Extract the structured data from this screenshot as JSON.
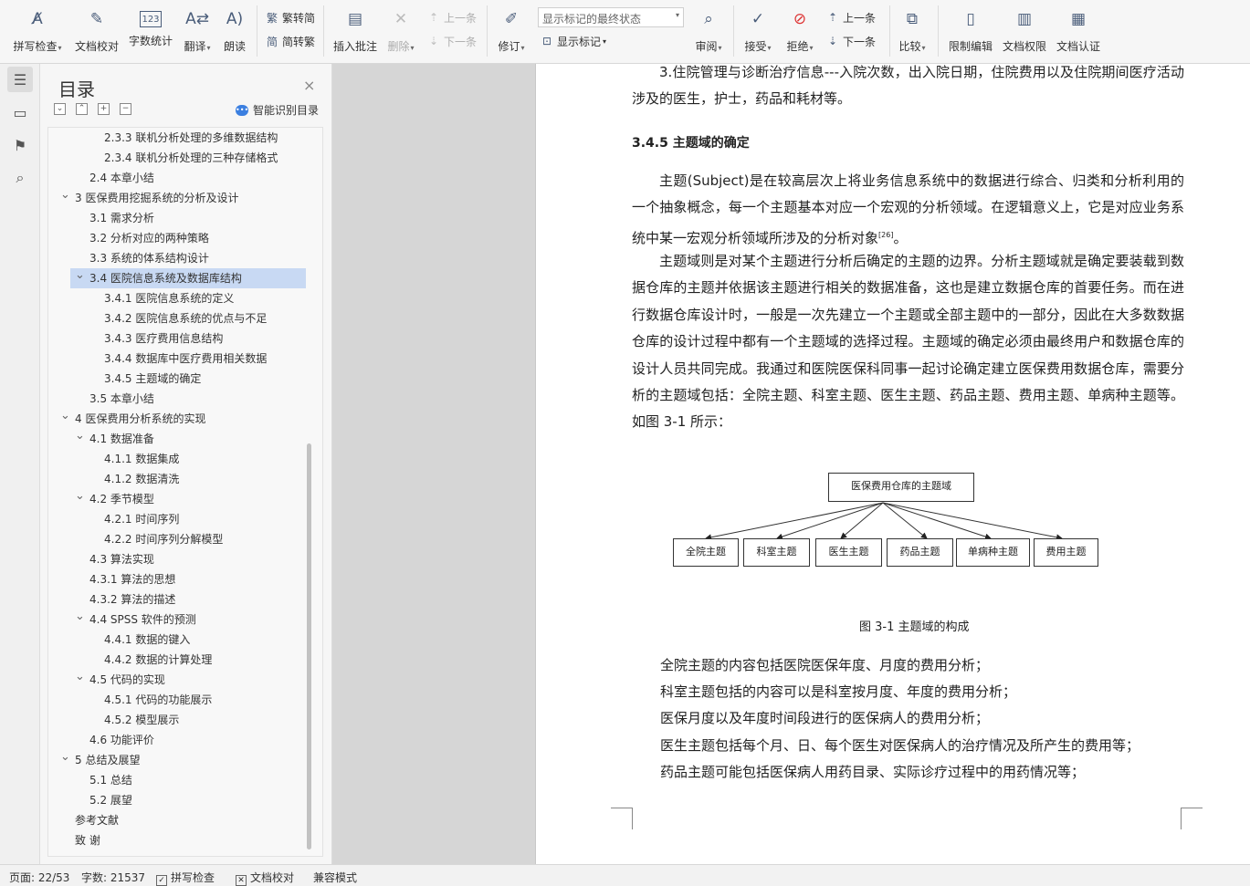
{
  "ribbon": {
    "spell_check": "拼写检查",
    "doc_proof": "文档校对",
    "word_count": "字数统计",
    "translate": "翻译",
    "read_aloud": "朗读",
    "trad_to_simp": "繁转简",
    "simp_to_trad": "简转繁",
    "insert_comment": "插入批注",
    "delete": "删除",
    "prev_comment": "上一条",
    "next_comment": "下一条",
    "track_changes": "修订",
    "markup_state": "显示标记的最终状态",
    "show_markup": "显示标记",
    "review": "审阅",
    "accept": "接受",
    "reject": "拒绝",
    "prev_change": "上一条",
    "next_change": "下一条",
    "compare": "比较",
    "restrict_edit": "限制编辑",
    "doc_permission": "文档权限",
    "doc_certify": "文档认证"
  },
  "toc": {
    "title": "目录",
    "smart_recognize": "智能识别目录",
    "items": [
      {
        "text": "2.3.3  联机分析处理的多维数据结构",
        "level": 3,
        "caret": ""
      },
      {
        "text": "2.3.4  联机分析处理的三种存储格式",
        "level": 3,
        "caret": ""
      },
      {
        "text": "2.4  本章小结",
        "level": 2,
        "caret": ""
      },
      {
        "text": "3  医保费用挖掘系统的分析及设计",
        "level": 1,
        "caret": "v"
      },
      {
        "text": "3.1  需求分析",
        "level": 2,
        "caret": ""
      },
      {
        "text": "3.2 分析对应的两种策略",
        "level": 2,
        "caret": ""
      },
      {
        "text": "3.3  系统的体系结构设计",
        "level": 2,
        "caret": ""
      },
      {
        "text": "3.4 医院信息系统及数据库结构",
        "level": 2,
        "caret": "v",
        "selected": true
      },
      {
        "text": "3.4.1 医院信息系统的定义",
        "level": 3,
        "caret": ""
      },
      {
        "text": "3.4.2 医院信息系统的优点与不足",
        "level": 3,
        "caret": ""
      },
      {
        "text": "3.4.3 医疗费用信息结构",
        "level": 3,
        "caret": ""
      },
      {
        "text": "3.4.4  数据库中医疗费用相关数据",
        "level": 3,
        "caret": ""
      },
      {
        "text": "3.4.5 主题域的确定",
        "level": 3,
        "caret": ""
      },
      {
        "text": "3.5    本章小结",
        "level": 2,
        "caret": ""
      },
      {
        "text": "4  医保费用分析系统的实现",
        "level": 1,
        "caret": "v"
      },
      {
        "text": "4.1  数据准备",
        "level": 2,
        "caret": "v"
      },
      {
        "text": "4.1.1  数据集成",
        "level": 3,
        "caret": ""
      },
      {
        "text": "4.1.2  数据清洗",
        "level": 3,
        "caret": ""
      },
      {
        "text": "4.2 季节模型",
        "level": 2,
        "caret": "v"
      },
      {
        "text": "4.2.1 时间序列",
        "level": 3,
        "caret": ""
      },
      {
        "text": "4.2.2  时间序列分解模型",
        "level": 3,
        "caret": ""
      },
      {
        "text": "4.3 算法实现",
        "level": 2,
        "caret": ""
      },
      {
        "text": "4.3.1 算法的思想",
        "level": 2,
        "caret": ""
      },
      {
        "text": "4.3.2 算法的描述",
        "level": 2,
        "caret": ""
      },
      {
        "text": "4.4 SPSS 软件的预测",
        "level": 2,
        "caret": "v"
      },
      {
        "text": "4.4.1  数据的键入",
        "level": 3,
        "caret": ""
      },
      {
        "text": "4.4.2 数据的计算处理",
        "level": 3,
        "caret": ""
      },
      {
        "text": "4.5  代码的实现",
        "level": 2,
        "caret": "v"
      },
      {
        "text": "4.5.1 代码的功能展示",
        "level": 3,
        "caret": ""
      },
      {
        "text": "4.5.2  模型展示",
        "level": 3,
        "caret": ""
      },
      {
        "text": "4.6 功能评价",
        "level": 2,
        "caret": ""
      },
      {
        "text": "5  总结及展望",
        "level": 1,
        "caret": "v"
      },
      {
        "text": "5.1 总结",
        "level": 2,
        "caret": ""
      },
      {
        "text": "5.2  展望",
        "level": 2,
        "caret": ""
      },
      {
        "text": "参考文献",
        "level": 1,
        "caret": ""
      },
      {
        "text": "致  谢",
        "level": 1,
        "caret": ""
      }
    ]
  },
  "document": {
    "para_top": "3.住院管理与诊断治疗信息---入院次数，出入院日期，住院费用以及住院期间医疗活动涉及的医生，护士，药品和耗材等。",
    "heading": "3.4.5 主题域的确定",
    "para1": "主题(Subject)是在较高层次上将业务信息系统中的数据进行综合、归类和分析利用的一个抽象概念，每一个主题基本对应一个宏观的分析领域。在逻辑意义上，它是对应业务系统中某一宏观分析领域所涉及的分析对象",
    "para1_ref": "[26]",
    "para1_end": "。",
    "para2": "主题域则是对某个主题进行分析后确定的主题的边界。分析主题域就是确定要装载到数据仓库的主题并依据该主题进行相关的数据准备，这也是建立数据仓库的首要任务。而在进行数据仓库设计时，一般是一次先建立一个主题或全部主题中的一部分，因此在大多数数据仓库的设计过程中都有一个主题域的选择过程。主题域的确定必须由最终用户和数据仓库的设计人员共同完成。我通过和医院医保科同事一起讨论确定建立医保费用数据仓库，需要分析的主题域包括：全院主题、科室主题、医生主题、药品主题、费用主题、单病种主题等。如图 3-1 所示：",
    "diagram": {
      "root": "医保费用仓库的主题域",
      "children": [
        "全院主题",
        "科室主题",
        "医生主题",
        "药品主题",
        "单病种主题",
        "费用主题"
      ]
    },
    "caption": "图 3-1  主题域的构成",
    "list": [
      "全院主题的内容包括医院医保年度、月度的费用分析；",
      "科室主题包括的内容可以是科室按月度、年度的费用分析；",
      "医保月度以及年度时间段进行的医保病人的费用分析；",
      "医生主题包括每个月、日、每个医生对医保病人的治疗情况及所产生的费用等；",
      "药品主题可能包括医保病人用药目录、实际诊疗过程中的用药情况等；"
    ]
  },
  "status": {
    "page": "页面: 22/53",
    "words": "字数: 21537",
    "spell": "拼写检查",
    "proof": "文档校对",
    "compat": "兼容模式"
  }
}
